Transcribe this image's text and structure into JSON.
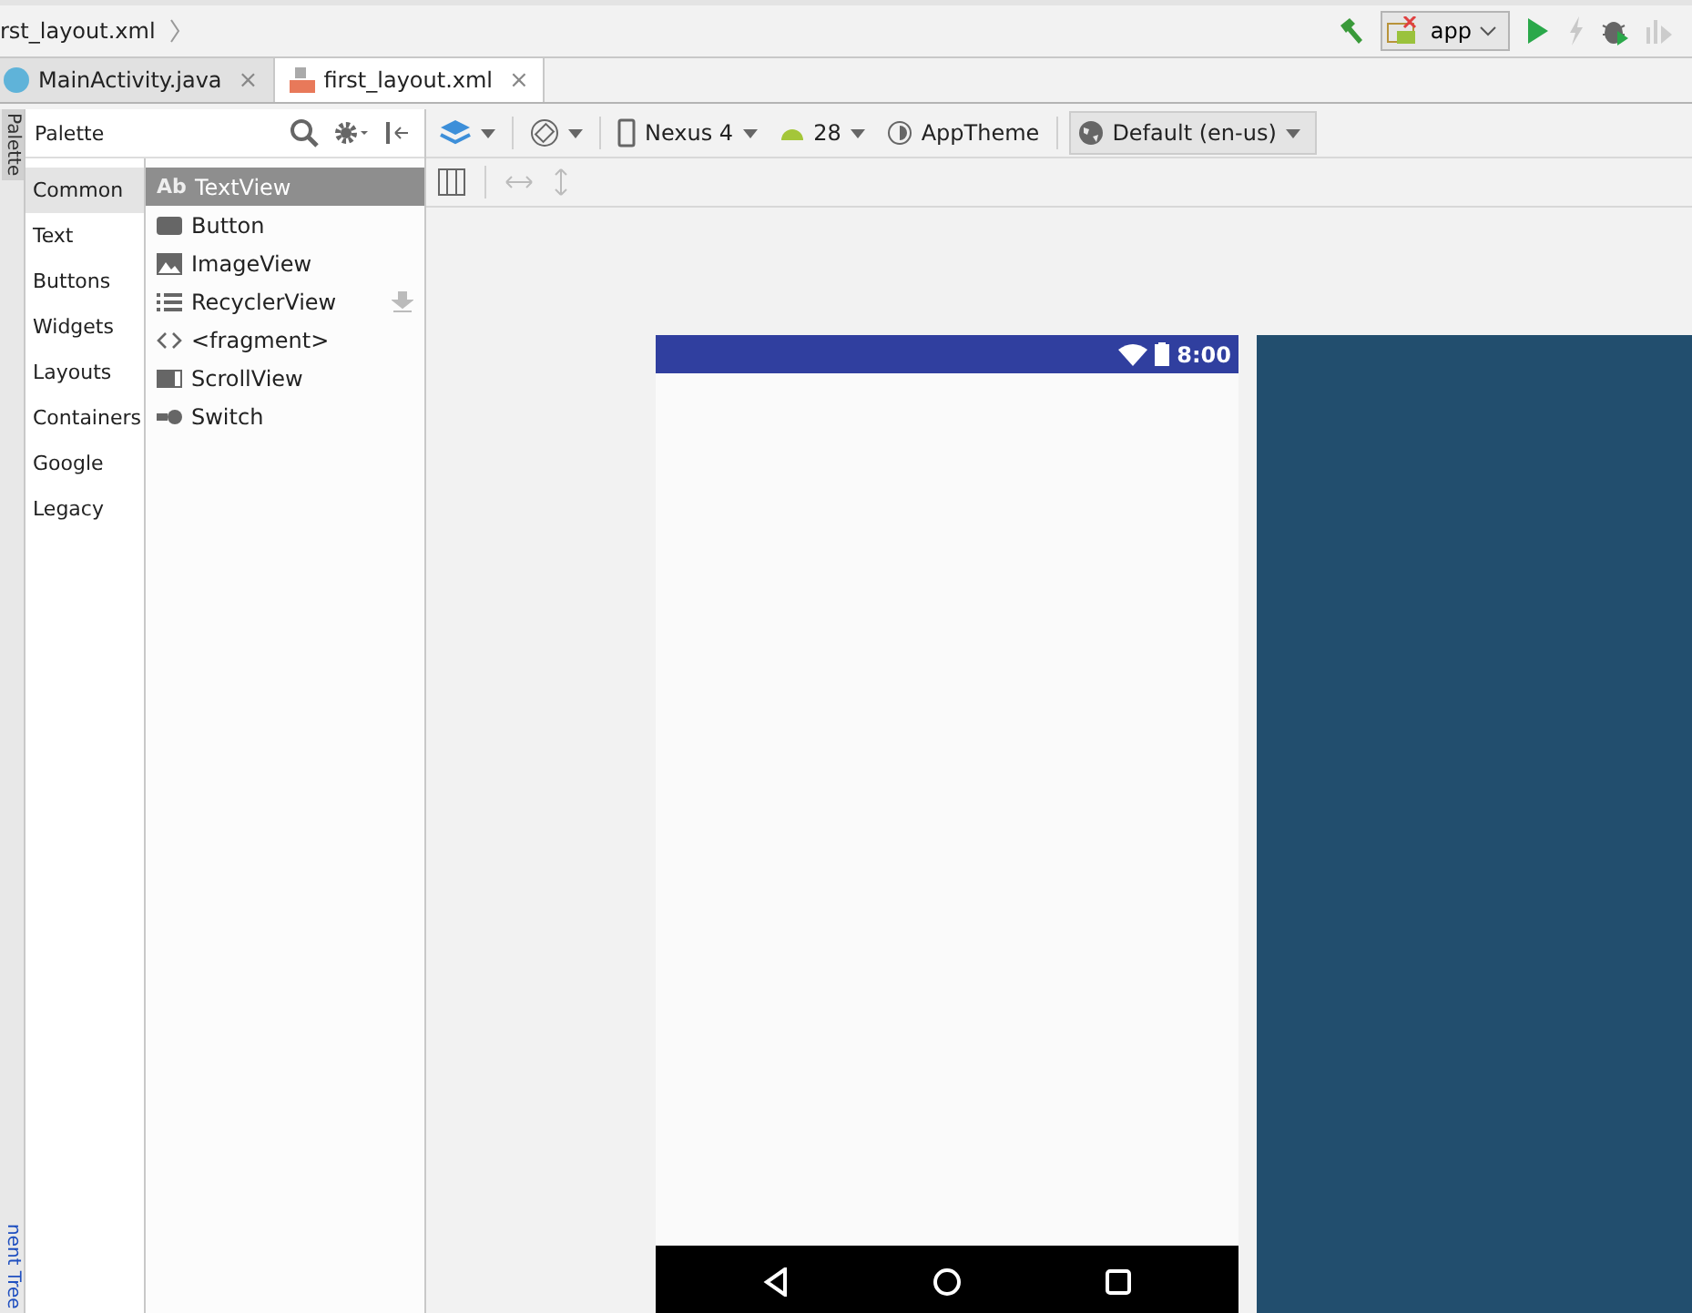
{
  "breadcrumb": "rst_layout.xml",
  "run_config": {
    "label": "app"
  },
  "tabs": [
    {
      "label": "MainActivity.java",
      "kind": "java",
      "close": "×",
      "selected": false
    },
    {
      "label": "first_layout.xml",
      "kind": "xml",
      "close": "×",
      "selected": true
    }
  ],
  "side_tools": [
    "Palette",
    "nent Tree"
  ],
  "palette": {
    "title": "Palette",
    "categories": [
      {
        "label": "Common",
        "selected": true
      },
      {
        "label": "Text",
        "selected": false
      },
      {
        "label": "Buttons",
        "selected": false
      },
      {
        "label": "Widgets",
        "selected": false
      },
      {
        "label": "Layouts",
        "selected": false
      },
      {
        "label": "Containers",
        "selected": false
      },
      {
        "label": "Google",
        "selected": false
      },
      {
        "label": "Legacy",
        "selected": false
      }
    ],
    "items": [
      {
        "label": "TextView",
        "kind": "text",
        "icon_text": "Ab",
        "selected": true
      },
      {
        "label": "Button",
        "kind": "button",
        "selected": false
      },
      {
        "label": "ImageView",
        "kind": "image",
        "selected": false
      },
      {
        "label": "RecyclerView",
        "kind": "list",
        "selected": false,
        "download": true
      },
      {
        "label": "<fragment>",
        "kind": "fragment",
        "selected": false
      },
      {
        "label": "ScrollView",
        "kind": "scroll",
        "selected": false
      },
      {
        "label": "Switch",
        "kind": "switch",
        "selected": false
      }
    ]
  },
  "design_toolbar": {
    "device": "Nexus 4",
    "api": "28",
    "theme": "AppTheme",
    "locale": "Default (en-us)"
  },
  "phone": {
    "time": "8:00"
  }
}
